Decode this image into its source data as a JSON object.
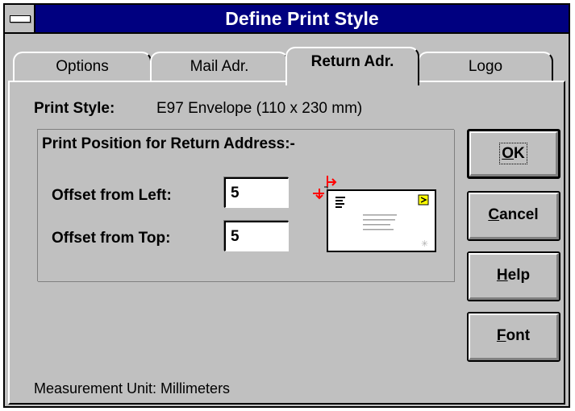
{
  "window": {
    "title": "Define Print Style"
  },
  "tabs": [
    {
      "label": "Options",
      "active": false
    },
    {
      "label": "Mail Adr.",
      "active": false
    },
    {
      "label": "Return Adr.",
      "active": true
    },
    {
      "label": "Logo",
      "active": false
    }
  ],
  "print_style": {
    "label": "Print Style:",
    "value": "E97 Envelope (110 x 230 mm)"
  },
  "group": {
    "title": "Print Position for Return Address:-",
    "offset_left": {
      "label": "Offset from Left:",
      "value": "5"
    },
    "offset_top": {
      "label": "Offset from Top:",
      "value": "5"
    }
  },
  "buttons": {
    "ok": {
      "accel": "O",
      "rest": "K"
    },
    "cancel": {
      "accel": "C",
      "rest": "ancel"
    },
    "help": {
      "accel": "H",
      "rest": "elp"
    },
    "font": {
      "accel": "F",
      "rest": "ont"
    }
  },
  "footer": {
    "measurement": "Measurement Unit: Millimeters"
  },
  "colors": {
    "titlebar": "#000080",
    "face": "#c0c0c0",
    "stamp": "#ffff00"
  },
  "icons": {
    "system_menu": "system-menu-icon",
    "envelope": "envelope-preview-icon"
  }
}
